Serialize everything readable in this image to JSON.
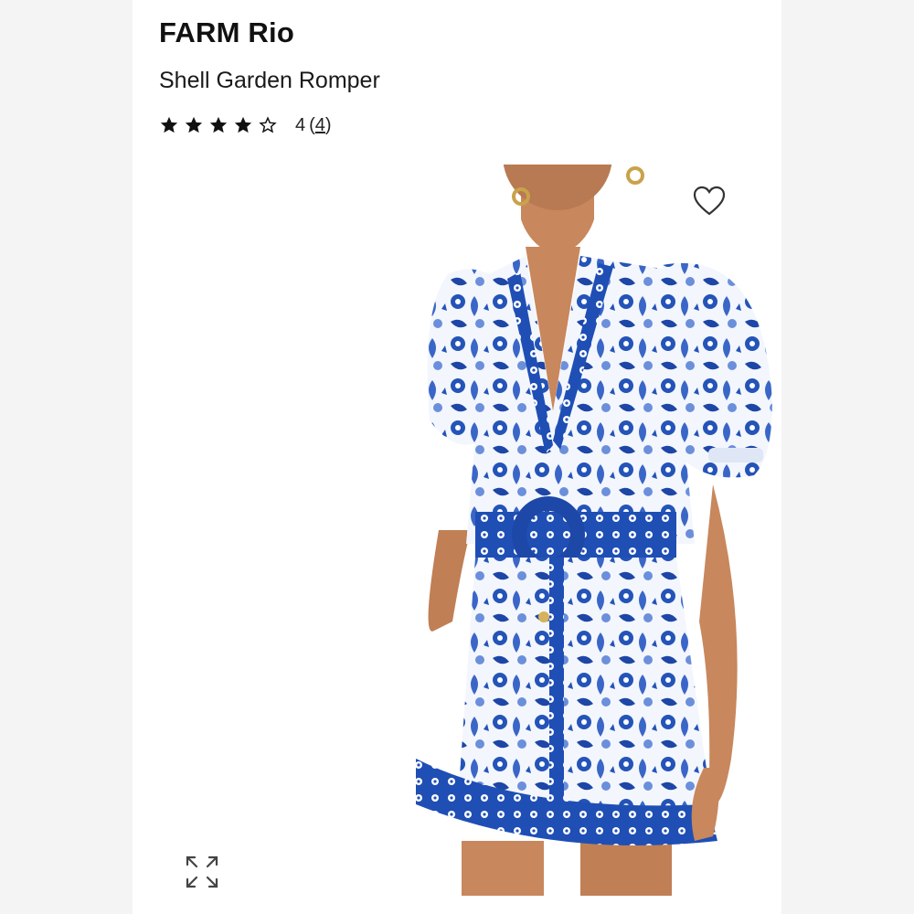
{
  "product": {
    "brand": "FARM Rio",
    "name": "Shell Garden Romper",
    "rating": {
      "value": 4,
      "max": 5,
      "value_label": "4",
      "count_label": "4"
    }
  },
  "image": {
    "subject": "model wearing blue and white printed romper with belt",
    "print_colors": [
      "#1f4fb5",
      "#ffffff",
      "#5b85d6"
    ]
  },
  "icons": {
    "wishlist": "heart-outline-icon",
    "expand": "expand-arrows-icon",
    "star_filled": "star-filled-icon",
    "star_empty": "star-outline-icon"
  }
}
